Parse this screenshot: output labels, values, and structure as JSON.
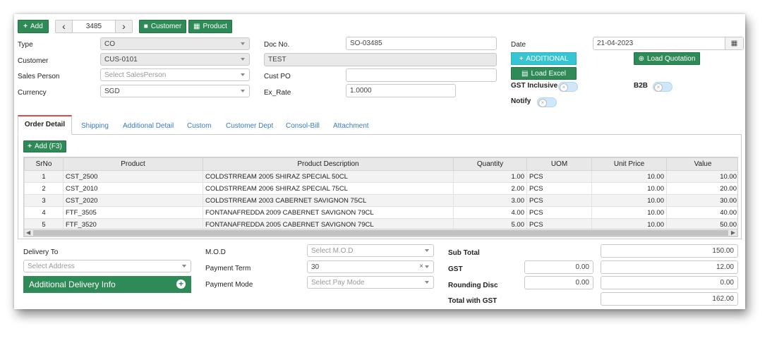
{
  "toolbar": {
    "add_label": "Add",
    "prev_label": "‹",
    "doc_number": "3485",
    "next_label": "›",
    "customer_label": "Customer",
    "product_label": "Product"
  },
  "form": {
    "type_label": "Type",
    "type_value": "CO",
    "customer_label": "Customer",
    "customer_value": "CUS-0101",
    "salesperson_label": "Sales Person",
    "salesperson_placeholder": "Select SalesPerson",
    "currency_label": "Currency",
    "currency_value": "SGD",
    "docno_label": "Doc No.",
    "docno_value": "SO-03485",
    "customer_name_value": "TEST",
    "custpo_label": "Cust PO",
    "custpo_value": "",
    "exrate_label": "Ex_Rate",
    "exrate_value": "1.0000",
    "date_label": "Date",
    "date_value": "21-04-2023",
    "additional_label": "ADDITIONAL",
    "load_excel_label": "Load Excel",
    "load_quotation_label": "Load Quotation",
    "gst_inclusive_label": "GST Inclusive",
    "b2b_label": "B2B",
    "notify_label": "Notify"
  },
  "tabs": [
    {
      "label": "Order Detail",
      "active": true
    },
    {
      "label": "Shipping"
    },
    {
      "label": "Additional Detail"
    },
    {
      "label": "Custom"
    },
    {
      "label": "Customer Dept"
    },
    {
      "label": "Consol-Bill"
    },
    {
      "label": "Attachment"
    }
  ],
  "grid": {
    "add_label": "Add (F3)",
    "columns": [
      "SrNo",
      "Product",
      "Product Description",
      "Quantity",
      "UOM",
      "Unit Price",
      "Value"
    ],
    "rows": [
      {
        "srno": "1",
        "product": "CST_2500",
        "desc": "COLDSTRREAM 2005 SHIRAZ SPECIAL 50CL",
        "qty": "1.00",
        "uom": "PCS",
        "price": "10.00",
        "value": "10.00"
      },
      {
        "srno": "2",
        "product": "CST_2010",
        "desc": "COLDSTRREAM 2006 SHIRAZ SPECIAL 75CL",
        "qty": "2.00",
        "uom": "PCS",
        "price": "10.00",
        "value": "20.00"
      },
      {
        "srno": "3",
        "product": "CST_2020",
        "desc": "COLDSTRREAM 2003 CABERNET SAVIGNON 75CL",
        "qty": "3.00",
        "uom": "PCS",
        "price": "10.00",
        "value": "30.00"
      },
      {
        "srno": "4",
        "product": "FTF_3505",
        "desc": "FONTANAFREDDA 2009 CABERNET SAVIGNON 79CL",
        "qty": "4.00",
        "uom": "PCS",
        "price": "10.00",
        "value": "40.00"
      },
      {
        "srno": "5",
        "product": "FTF_3520",
        "desc": "FONTANAFREDDA 2005 CABERNET SAVIGNON 79CL",
        "qty": "5.00",
        "uom": "PCS",
        "price": "10.00",
        "value": "50.00"
      }
    ]
  },
  "footer": {
    "delivery_to_label": "Delivery To",
    "address_placeholder": "Select Address",
    "additional_delivery_label": "Additional Delivery Info",
    "mod_label": "M.O.D",
    "mod_placeholder": "Select M.O.D",
    "payment_term_label": "Payment Term",
    "payment_term_value": "30",
    "payment_mode_label": "Payment Mode",
    "payment_mode_placeholder": "Select Pay Mode",
    "subtotal_label": "Sub Total",
    "subtotal_value": "150.00",
    "gst_label": "GST",
    "gst_rate_value": "0.00",
    "gst_value": "12.00",
    "rounding_label": "Rounding Disc",
    "rounding_rate_value": "0.00",
    "rounding_value": "0.00",
    "total_label": "Total with GST",
    "total_value": "162.00"
  },
  "colors": {
    "green": "#2e8b57",
    "teal": "#36c6d3",
    "active_tab_border": "#e24a4a",
    "link": "#3a7cc0"
  }
}
